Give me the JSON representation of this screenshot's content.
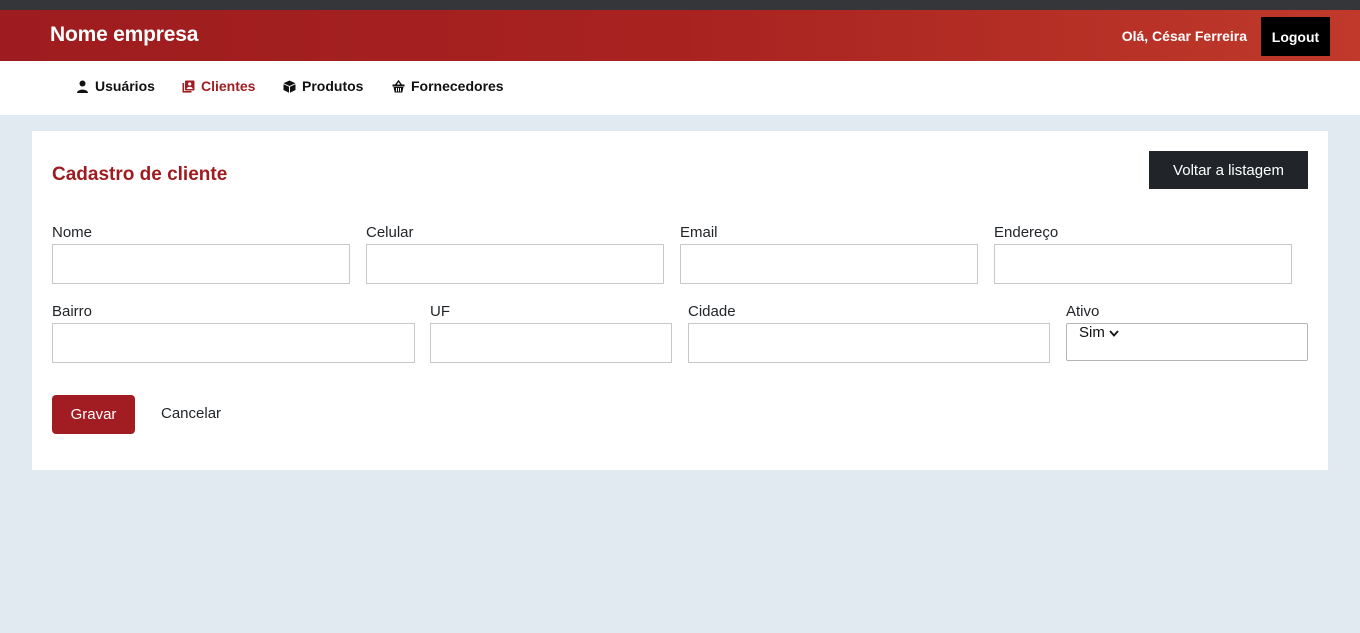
{
  "header": {
    "brand": "Nome empresa",
    "greeting": "Olá, César Ferreira",
    "logout_label": "Logout"
  },
  "nav": {
    "items": [
      {
        "label": "Usuários",
        "icon": "user-icon"
      },
      {
        "label": "Clientes",
        "icon": "address-book-icon",
        "active": true
      },
      {
        "label": "Produtos",
        "icon": "box-icon"
      },
      {
        "label": "Fornecedores",
        "icon": "basket-icon"
      }
    ]
  },
  "form": {
    "title": "Cadastro de cliente",
    "back_label": "Voltar a listagem",
    "fields": {
      "nome": {
        "label": "Nome",
        "value": ""
      },
      "celular": {
        "label": "Celular",
        "value": ""
      },
      "email": {
        "label": "Email",
        "value": ""
      },
      "endereco": {
        "label": "Endereço",
        "value": ""
      },
      "bairro": {
        "label": "Bairro",
        "value": ""
      },
      "uf": {
        "label": "UF",
        "value": ""
      },
      "cidade": {
        "label": "Cidade",
        "value": ""
      },
      "ativo": {
        "label": "Ativo",
        "value": "Sim"
      }
    },
    "save_label": "Gravar",
    "cancel_label": "Cancelar"
  },
  "colors": {
    "brand_red": "#a11d22",
    "background": "#e1eaf1",
    "dark_button": "#212529"
  }
}
